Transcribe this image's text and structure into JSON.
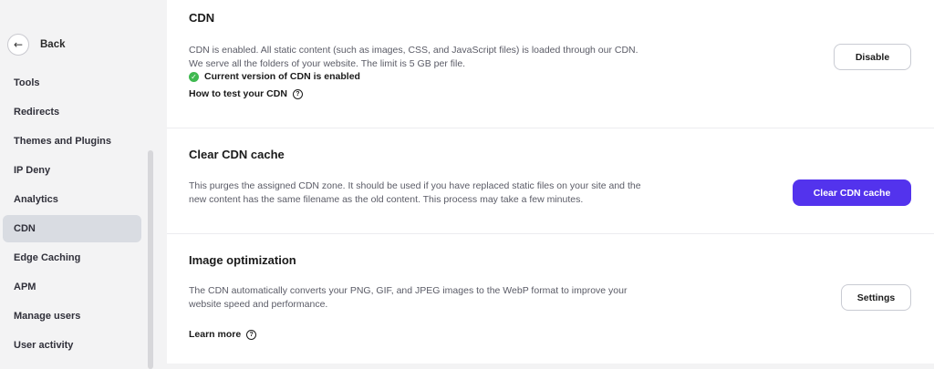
{
  "sidebar": {
    "back_label": "Back",
    "back_icon": "←",
    "items": [
      {
        "label": "Tools",
        "active": false
      },
      {
        "label": "Redirects",
        "active": false
      },
      {
        "label": "Themes and Plugins",
        "active": false
      },
      {
        "label": "IP Deny",
        "active": false
      },
      {
        "label": "Analytics",
        "active": false
      },
      {
        "label": "CDN",
        "active": true
      },
      {
        "label": "Edge Caching",
        "active": false
      },
      {
        "label": "APM",
        "active": false
      },
      {
        "label": "Manage users",
        "active": false
      },
      {
        "label": "User activity",
        "active": false
      }
    ]
  },
  "cdn": {
    "title": "CDN",
    "description_line1": "CDN is enabled. All static content (such as images, CSS, and JavaScript files) is loaded through our CDN.",
    "description_line2": "We serve all the folders of your website. The limit is 5 GB per file.",
    "status": "Current version of CDN is enabled",
    "help_link": "How to test your CDN",
    "disable_button": "Disable"
  },
  "clear_cache": {
    "title": "Clear CDN cache",
    "description_line1": "This purges the assigned CDN zone. It should be used if you have replaced static files on your site and the",
    "description_line2": "new content has the same filename as the old content. This process may take a few minutes.",
    "button": "Clear CDN cache"
  },
  "image_opt": {
    "title": "Image optimization",
    "description_line1": "The CDN automatically converts your PNG, GIF, and JPEG images to the WebP format to improve your",
    "description_line2": "website speed and performance.",
    "learn_more": "Learn more",
    "settings_button": "Settings"
  },
  "colors": {
    "accent": "#5333ed",
    "success": "#3fb950",
    "active_nav": "#d9dce2"
  }
}
